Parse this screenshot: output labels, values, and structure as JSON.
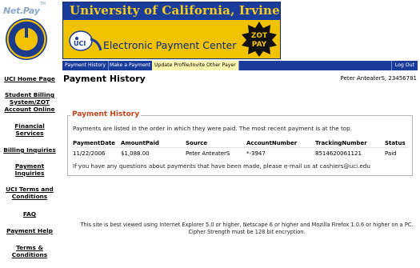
{
  "sidebar": {
    "logo_text": "Net.Pay",
    "logo_tm": "TM",
    "links": [
      {
        "label": "UCI Home Page"
      },
      {
        "label": "Student Billing System/ZOT Account Online"
      },
      {
        "label": "Financial Services"
      },
      {
        "label": "Billing Inquiries"
      },
      {
        "label": "Payment Inquiries"
      },
      {
        "label": "UCI Terms and Conditions"
      },
      {
        "label": "FAQ"
      },
      {
        "label": "Payment Help"
      },
      {
        "label": "Terms & Conditions"
      }
    ]
  },
  "banner": {
    "title": "University of California, Irvine",
    "subtitle": "Electronic Payment Center",
    "mascot_text": "UCI",
    "badge_line1": "ZOT",
    "badge_line2": "PAY"
  },
  "nav": {
    "items": [
      {
        "label": "Payment History"
      },
      {
        "label": "Make a Payment"
      },
      {
        "label": "Update Profile/Invite Other Payer"
      }
    ],
    "logout": "Log Out"
  },
  "page": {
    "title": "Payment History",
    "user": "Peter AnteaterS, 23456781"
  },
  "history": {
    "legend": "Payment History",
    "description": "Payments are listed in the order in which they were paid. The most recent payment is at the top.",
    "columns": [
      "PaymentDate",
      "AmountPaid",
      "Source",
      "AccountNumber",
      "TrackingNumber",
      "Status"
    ],
    "rows": [
      [
        "11/22/2006",
        "$1,088.00",
        "Peter AnteaterS",
        "*-3947",
        "8514620061121",
        "Paid"
      ]
    ],
    "contact": "If you have any questions about payments that have been made, please e-mail us at cashiers@uci.edu"
  },
  "footer": {
    "line1": "This site is best viewed using Internet Explorer 5.0 or higher, Netscape 6 or higher and Mozilla Firefox 1.0.6 or higher on a PC.",
    "line2": "Cipher Strength must be 128 bit encryption."
  },
  "colors": {
    "brand_blue": "#1a3d9c",
    "brand_gold": "#f0c200",
    "legend_orange": "#c0441a",
    "active_tab": "#fff7b0"
  }
}
